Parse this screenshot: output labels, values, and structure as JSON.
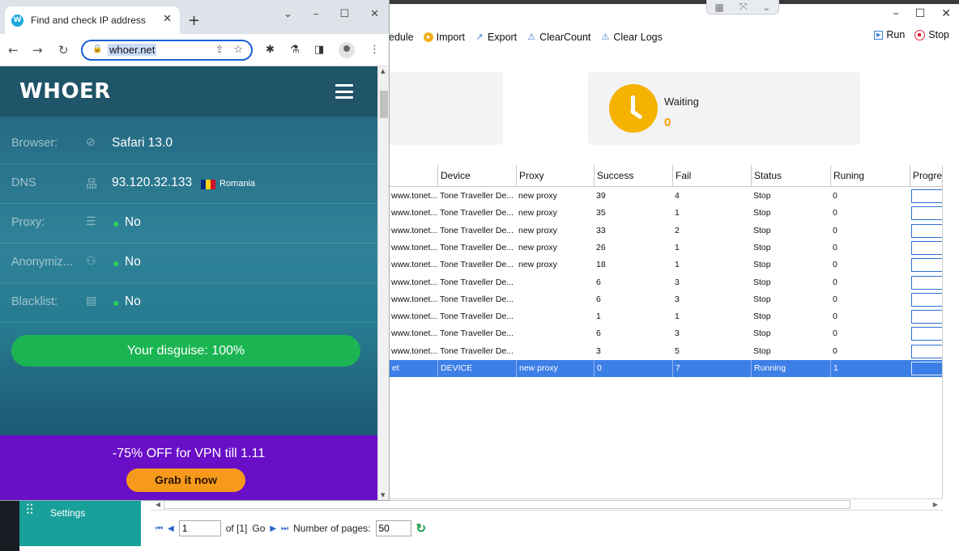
{
  "app": {
    "snap_icons": [
      "grid-icon",
      "pin-icon",
      "chevron-icon"
    ],
    "toolbar": {
      "schedule": "edule",
      "import": "Import",
      "export": "Export",
      "clear_count": "ClearCount",
      "clear_logs": "Clear Logs",
      "run": "Run",
      "stop": "Stop"
    },
    "status": {
      "label": "Waiting",
      "count": "0"
    },
    "table": {
      "headers": [
        "Device",
        "Proxy",
        "Success",
        "Fail",
        "Status",
        "Runing",
        "Progres"
      ],
      "rows": [
        [
          "www.tonet...",
          "Tone Traveller De...",
          "new proxy",
          "39",
          "4",
          "Stop",
          "0"
        ],
        [
          "www.tonet...",
          "Tone Traveller De...",
          "new proxy",
          "35",
          "1",
          "Stop",
          "0"
        ],
        [
          "www.tonet...",
          "Tone Traveller De...",
          "new proxy",
          "33",
          "2",
          "Stop",
          "0"
        ],
        [
          "www.tonet...",
          "Tone Traveller De...",
          "new proxy",
          "26",
          "1",
          "Stop",
          "0"
        ],
        [
          "www.tonet...",
          "Tone Traveller De...",
          "new proxy",
          "18",
          "1",
          "Stop",
          "0"
        ],
        [
          "www.tonet...",
          "Tone Traveller De...",
          "",
          "6",
          "3",
          "Stop",
          "0"
        ],
        [
          "www.tonet...",
          "Tone Traveller De...",
          "",
          "6",
          "3",
          "Stop",
          "0"
        ],
        [
          "www.tonet...",
          "Tone Traveller De...",
          "",
          "1",
          "1",
          "Stop",
          "0"
        ],
        [
          "www.tonet...",
          "Tone Traveller De...",
          "",
          "6",
          "3",
          "Stop",
          "0"
        ],
        [
          "www.tonet...",
          "Tone Traveller De...",
          "",
          "3",
          "5",
          "Stop",
          "0"
        ],
        [
          "et",
          "DEVICE",
          "new proxy",
          "0",
          "7",
          "Running",
          "1"
        ]
      ],
      "selected_row": 10
    },
    "pager": {
      "page": "1",
      "of_text": "of [1]",
      "go": "Go",
      "pages_label": "Number of pages:",
      "pages_value": "50"
    },
    "settings_label": "Settings"
  },
  "browser": {
    "tab_title": "Find and check IP address",
    "url": "whoer.net",
    "site": {
      "logo": "WHOER",
      "rows": [
        {
          "label": "Browser:",
          "value": "Safari 13.0",
          "icon": "compass-icon"
        },
        {
          "label": "DNS",
          "value": "93.120.32.133",
          "icon": "network-icon",
          "country": "Romania"
        },
        {
          "label": "Proxy:",
          "value": "No",
          "icon": "database-icon"
        },
        {
          "label": "Anonymiz...",
          "value": "No",
          "icon": "user-icon"
        },
        {
          "label": "Blacklist:",
          "value": "No",
          "icon": "list-icon"
        }
      ],
      "disguise": "Your disguise: 100%",
      "promo": "-75% OFF for VPN till 1.11",
      "promo_button": "Grab it now"
    }
  },
  "colors": {
    "whoer_header": "#205468",
    "disguise_green": "#1ab552",
    "promo_purple": "#6a0fc8",
    "promo_button": "#f79a1b",
    "selected_row": "#3c7fe6",
    "waiting_clock": "#f6b200",
    "settings_tile": "#1aa09a"
  }
}
